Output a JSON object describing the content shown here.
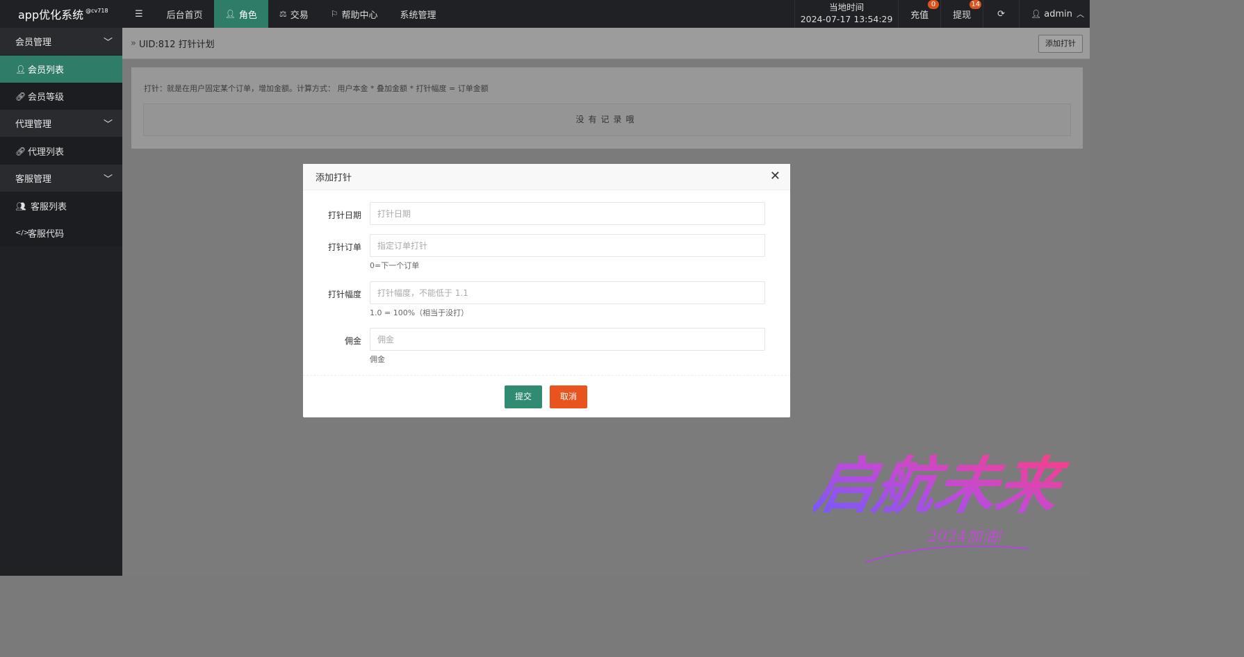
{
  "brand": {
    "name": "app优化系统",
    "tag": "@cv718"
  },
  "nav": {
    "menu_toggle_icon": "hamburger-icon",
    "items": [
      {
        "label": "后台首页",
        "icon": ""
      },
      {
        "label": "角色",
        "icon": "user-icon",
        "active": true
      },
      {
        "label": "交易",
        "icon": "scale-icon"
      },
      {
        "label": "帮助中心",
        "icon": "flag-icon"
      },
      {
        "label": "系统管理",
        "icon": ""
      }
    ]
  },
  "top_right": {
    "time_label": "当地时间",
    "time_value": "2024-07-17 13:54:29",
    "recharge": {
      "label": "充值",
      "count": "0"
    },
    "withdraw": {
      "label": "提现",
      "count": "14"
    },
    "refresh_icon": "refresh-icon",
    "user": {
      "name": "admin",
      "icon": "user-icon"
    }
  },
  "sidebar": {
    "groups": [
      {
        "label": "会员管理",
        "items": [
          {
            "label": "会员列表",
            "icon": "user-icon",
            "active": true
          },
          {
            "label": "会员等级",
            "icon": "link-icon"
          }
        ]
      },
      {
        "label": "代理管理",
        "items": [
          {
            "label": "代理列表",
            "icon": "link-icon"
          }
        ]
      },
      {
        "label": "客服管理",
        "items": [
          {
            "label": "客服列表",
            "icon": "users-icon"
          },
          {
            "label": "客服代码",
            "icon": "code-icon"
          }
        ]
      }
    ]
  },
  "page": {
    "breadcrumb": "UID:812 打针计划",
    "add_button": "添加打针",
    "tip": "打针：就是在用户固定某个订单，增加金额。计算方式： 用户本金 * 叠加金额 * 打针幅度 = 订单金额",
    "empty_text": "没有记录哦"
  },
  "modal": {
    "title": "添加打针",
    "fields": [
      {
        "label": "打针日期",
        "placeholder": "打针日期",
        "value": "",
        "hint": ""
      },
      {
        "label": "打针订单",
        "placeholder": "指定订单打针",
        "value": "",
        "hint": "0=下一个订单"
      },
      {
        "label": "打针幅度",
        "placeholder": "打针幅度，不能低于 1.1",
        "value": "",
        "hint": "1.0 = 100%（相当于没打）"
      },
      {
        "label": "佣金",
        "placeholder": "佣金",
        "value": "",
        "hint": "佣金"
      }
    ],
    "submit_label": "提交",
    "cancel_label": "取消"
  },
  "watermark": {
    "main": "启航未来",
    "sub": "2024加油!"
  },
  "colors": {
    "accent": "#2f7d68",
    "danger": "#e9541e",
    "topbar": "#202124"
  }
}
